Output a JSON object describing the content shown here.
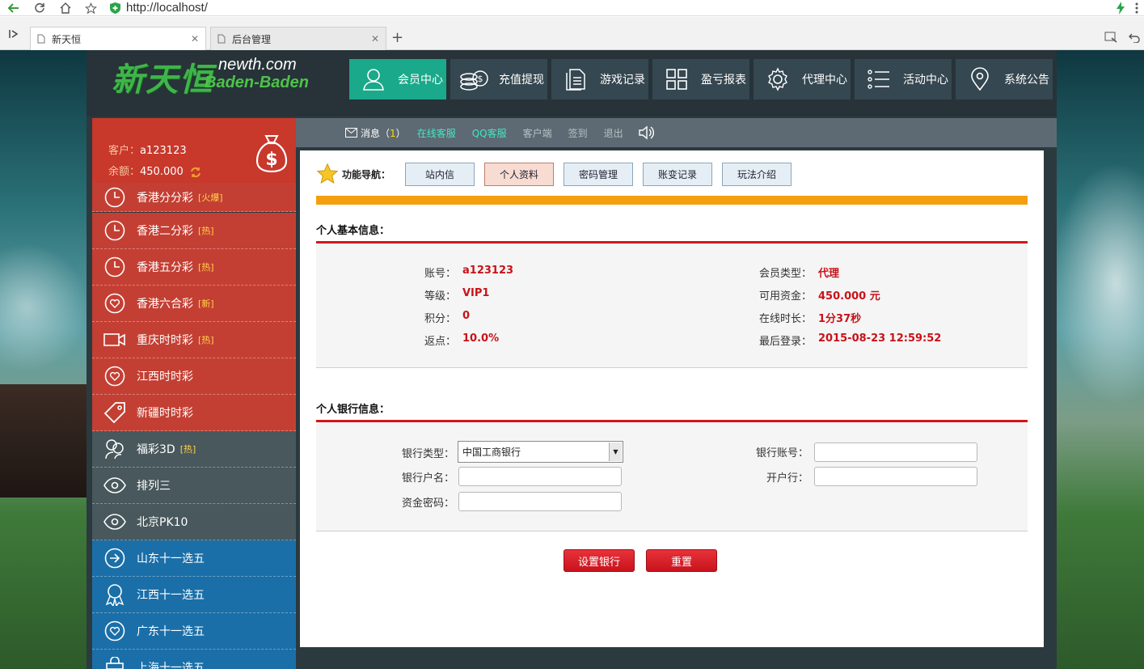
{
  "browser": {
    "url": "http://localhost/",
    "tabs": [
      {
        "label": "新天恒",
        "active": true
      },
      {
        "label": "后台管理",
        "active": false
      }
    ]
  },
  "logo": {
    "cn": "新天恒",
    "domain": "newth.com",
    "sub": "Baden-Baden"
  },
  "nav": [
    {
      "label": "会员中心",
      "icon": "user-icon",
      "active": true
    },
    {
      "label": "充值提现",
      "icon": "coins-icon"
    },
    {
      "label": "游戏记录",
      "icon": "document-icon"
    },
    {
      "label": "盈亏报表",
      "icon": "grid-icon"
    },
    {
      "label": "代理中心",
      "icon": "gear-icon"
    },
    {
      "label": "活动中心",
      "icon": "list-icon"
    },
    {
      "label": "系统公告",
      "icon": "location-pin-icon"
    }
  ],
  "account": {
    "customer_label": "客户：",
    "customer": "a123123",
    "balance_label": "余额：",
    "balance": "450.000"
  },
  "sidebar": [
    {
      "label": "香港分分彩",
      "tag": "[火爆]",
      "icon": "clock-icon",
      "color": "red"
    },
    {
      "label": "香港二分彩",
      "tag": "[热]",
      "icon": "clock-icon",
      "color": "red"
    },
    {
      "label": "香港五分彩",
      "tag": "[热]",
      "icon": "clock-icon",
      "color": "red"
    },
    {
      "label": "香港六合彩",
      "tag": "[新]",
      "icon": "heart-circle-icon",
      "color": "red"
    },
    {
      "label": "重庆时时彩",
      "tag": "[热]",
      "icon": "video-camera-icon",
      "color": "red"
    },
    {
      "label": "江西时时彩",
      "tag": "",
      "icon": "heart-circle-icon",
      "color": "red"
    },
    {
      "label": "新疆时时彩",
      "tag": "",
      "icon": "tag-icon",
      "color": "red"
    },
    {
      "label": "福彩3D",
      "tag": "[热]",
      "icon": "users-icon",
      "color": "gray"
    },
    {
      "label": "排列三",
      "tag": "",
      "icon": "eye-icon",
      "color": "gray"
    },
    {
      "label": "北京PK10",
      "tag": "",
      "icon": "eye-icon",
      "color": "gray"
    },
    {
      "label": "山东十一选五",
      "tag": "",
      "icon": "arrow-circle-icon",
      "color": "blue"
    },
    {
      "label": "江西十一选五",
      "tag": "",
      "icon": "award-ribbon-icon",
      "color": "blue"
    },
    {
      "label": "广东十一选五",
      "tag": "",
      "icon": "heart-circle-icon",
      "color": "blue"
    },
    {
      "label": "上海十一选五",
      "tag": "",
      "icon": "bag-icon",
      "color": "blue"
    }
  ],
  "strip": {
    "message_label": "消息",
    "message_count": "1",
    "online_service": "在线客服",
    "qq_service": "QQ客服",
    "client": "客户端",
    "checkin": "签到",
    "logout": "退出"
  },
  "func_nav": {
    "label": "功能导航：",
    "buttons": [
      {
        "label": "站内信",
        "active": false
      },
      {
        "label": "个人资料",
        "active": true
      },
      {
        "label": "密码管理",
        "active": false
      },
      {
        "label": "账变记录",
        "active": false
      },
      {
        "label": "玩法介绍",
        "active": false
      }
    ]
  },
  "basic_info": {
    "title": "个人基本信息：",
    "left": [
      {
        "label": "账号：",
        "value": "a123123"
      },
      {
        "label": "等级：",
        "value": "VIP1"
      },
      {
        "label": "积分：",
        "value": "0"
      },
      {
        "label": "返点：",
        "value": "10.0%"
      }
    ],
    "right": [
      {
        "label": "会员类型：",
        "value": "代理"
      },
      {
        "label": "可用资金：",
        "value": "450.000 元"
      },
      {
        "label": "在线时长：",
        "value": "1分37秒"
      },
      {
        "label": "最后登录：",
        "value": "2015-08-23 12:59:52"
      }
    ]
  },
  "bank_info": {
    "title": "个人银行信息：",
    "bank_type_label": "银行类型：",
    "bank_type_value": "中国工商银行",
    "account_name_label": "银行户名：",
    "fund_password_label": "资金密码：",
    "bank_account_label": "银行账号：",
    "branch_label": "开户行：",
    "submit": "设置银行",
    "reset": "重置"
  },
  "colors": {
    "accent_green": "#1aa98a",
    "value_red": "#c8121a",
    "orange_bar": "#f49f0f"
  }
}
